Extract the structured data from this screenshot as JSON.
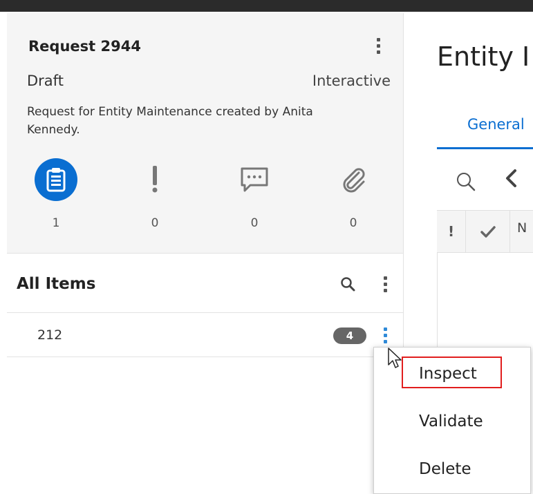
{
  "request": {
    "title": "Request 2944",
    "status": "Draft",
    "mode": "Interactive",
    "description": "Request for Entity Maintenance created by Anita Kennedy."
  },
  "stats": [
    {
      "icon": "clipboard-icon",
      "count": "1"
    },
    {
      "icon": "exclamation-icon",
      "count": "0"
    },
    {
      "icon": "comment-icon",
      "count": "0"
    },
    {
      "icon": "paperclip-icon",
      "count": "0"
    }
  ],
  "items": {
    "header": "All Items",
    "rows": [
      {
        "name": "212",
        "badge": "4"
      }
    ]
  },
  "main": {
    "title": "Entity I",
    "tab_general": "General",
    "table": {
      "col_warn": "!",
      "col_name": "N"
    }
  },
  "context_menu": {
    "items": [
      "Inspect",
      "Validate",
      "Delete"
    ],
    "highlighted": "Inspect"
  },
  "colors": {
    "accent": "#0a6ed1",
    "highlight": "#e11d1d",
    "badge": "#666666",
    "kebab_active": "#2f8ad8"
  }
}
